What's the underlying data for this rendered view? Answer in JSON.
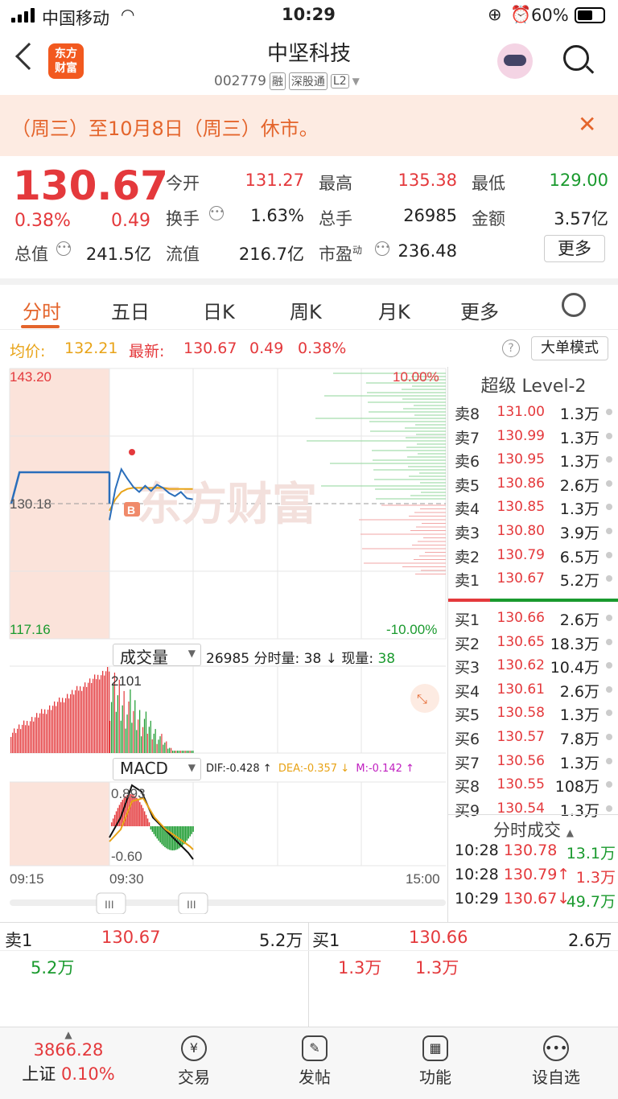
{
  "status_bar": {
    "carrier": "中国移动",
    "time": "10:29",
    "battery": "60%"
  },
  "header": {
    "logo_text": "东方\n财富",
    "title": "中坚科技",
    "code": "002779",
    "tags": [
      "融",
      "深股通",
      "L2"
    ]
  },
  "notice": {
    "text": "（周三）至10月8日（周三）休市。",
    "close": "✕"
  },
  "quote": {
    "price": "130.67",
    "change_pct": "0.38%",
    "change": "0.49",
    "fields": [
      {
        "label": "今开",
        "value": "131.27",
        "color": "red"
      },
      {
        "label": "最高",
        "value": "135.38",
        "color": "red"
      },
      {
        "label": "最低",
        "value": "129.00",
        "color": "green"
      },
      {
        "label": "换手",
        "value": "1.63%",
        "color": "dark"
      },
      {
        "label": "总手",
        "value": "26985",
        "color": "dark"
      },
      {
        "label": "金额",
        "value": "3.57亿",
        "color": "dark"
      },
      {
        "label": "总值",
        "value": "241.5亿",
        "color": "dark"
      },
      {
        "label": "流值",
        "value": "216.7亿",
        "color": "dark"
      },
      {
        "label": "市盈",
        "sup": "动",
        "value": "236.48",
        "color": "dark"
      }
    ],
    "more": "更多"
  },
  "tabs": [
    "分时",
    "五日",
    "日K",
    "周K",
    "月K",
    "更多"
  ],
  "avg": {
    "avg_label": "均价:",
    "avg_value": "132.21",
    "last_label": "最新:",
    "last_value": "130.67",
    "chg": "0.49",
    "pct": "0.38%",
    "big_order": "大单模式"
  },
  "chart_data": {
    "type": "line",
    "price_axis": {
      "max": "143.20",
      "ref": "130.18",
      "min": "117.16",
      "max_pct": "10.00%",
      "min_pct": "-10.00%"
    },
    "time_axis": [
      "09:15",
      "09:30",
      "15:00"
    ],
    "volume_label": "成交量",
    "volume_total": "26985",
    "volume_info": "分时量: 38 ↓ 现量:",
    "volume_now": "38",
    "volume_max": "2101",
    "macd_label": "MACD",
    "dif": "DIF:-0.428 ↑",
    "dea": "DEA:-0.357 ↓",
    "m": "M:-0.142 ↑",
    "macd_top": "0.893",
    "macd_bottom": "-0.60",
    "buy_marker": "B",
    "watermark": "东方财富",
    "price_series": [
      128.6,
      131.6,
      133.5,
      132.6,
      131.8,
      131.3,
      131.9,
      131.4,
      132.0,
      131.7,
      131.2,
      130.9,
      131.3,
      130.7,
      130.6
    ],
    "avg_series": [
      129.5,
      130.6,
      131.3,
      131.6,
      131.7,
      131.7,
      131.7,
      131.7,
      131.7,
      131.7,
      131.6,
      131.6,
      131.6,
      131.6,
      131.6
    ],
    "auction_series": [
      130.2,
      133.2,
      133.2,
      133.2,
      133.2,
      133.2,
      133.2,
      133.2,
      133.2,
      133.2,
      133.2,
      133.2,
      133.2
    ]
  },
  "level2": {
    "title": "超级 Level-2",
    "asks": [
      {
        "label": "卖8",
        "price": "131.00",
        "vol": "1.3万"
      },
      {
        "label": "卖7",
        "price": "130.99",
        "vol": "1.3万"
      },
      {
        "label": "卖6",
        "price": "130.95",
        "vol": "1.3万"
      },
      {
        "label": "卖5",
        "price": "130.86",
        "vol": "2.6万"
      },
      {
        "label": "卖4",
        "price": "130.85",
        "vol": "1.3万"
      },
      {
        "label": "卖3",
        "price": "130.80",
        "vol": "3.9万"
      },
      {
        "label": "卖2",
        "price": "130.79",
        "vol": "6.5万"
      },
      {
        "label": "卖1",
        "price": "130.67",
        "vol": "5.2万"
      }
    ],
    "bids": [
      {
        "label": "买1",
        "price": "130.66",
        "vol": "2.6万"
      },
      {
        "label": "买2",
        "price": "130.65",
        "vol": "18.3万"
      },
      {
        "label": "买3",
        "price": "130.62",
        "vol": "10.4万"
      },
      {
        "label": "买4",
        "price": "130.61",
        "vol": "2.6万"
      },
      {
        "label": "买5",
        "price": "130.58",
        "vol": "1.3万"
      },
      {
        "label": "买6",
        "price": "130.57",
        "vol": "7.8万"
      },
      {
        "label": "买7",
        "price": "130.56",
        "vol": "1.3万"
      },
      {
        "label": "买8",
        "price": "130.55",
        "vol": "108万"
      },
      {
        "label": "买9",
        "price": "130.54",
        "vol": "1.3万"
      }
    ],
    "trades_title": "分时成交",
    "trades": [
      {
        "time": "10:28",
        "price": "130.78",
        "vol": "13.1万"
      },
      {
        "time": "10:28",
        "price": "130.79↑",
        "vol": "1.3万"
      },
      {
        "time": "10:29",
        "price": "130.67↓",
        "vol": "49.7万"
      }
    ]
  },
  "bidask": {
    "ask_label": "卖1",
    "ask_price": "130.67",
    "ask_vol": "5.2万",
    "ask_detail": "5.2万",
    "bid_label": "买1",
    "bid_price": "130.66",
    "bid_vol": "2.6万",
    "bid_detail_1": "1.3万",
    "bid_detail_2": "1.3万"
  },
  "nav": {
    "index_value": "3866.28",
    "index_name": "上证",
    "index_pct": "0.10%",
    "items": [
      "交易",
      "发帖",
      "功能",
      "设自选"
    ]
  }
}
